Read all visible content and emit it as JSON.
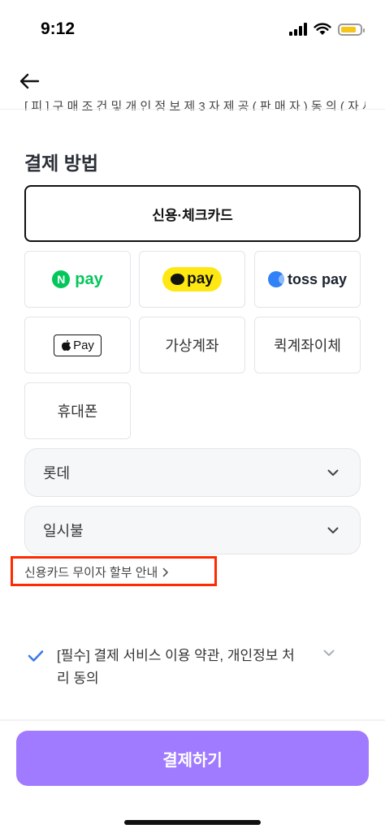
{
  "status_bar": {
    "time": "9:12"
  },
  "header": {
    "back_icon": "arrow-left-icon",
    "clipped_line": "[ 피 ] 구 매 조 건 및 개 인 정 보 제 3 자 제 공 ( 판 매 자 ) 동 의 ( 자 세 히 )"
  },
  "payment": {
    "title": "결제 방법",
    "card_label": "신용·체크카드",
    "methods": {
      "npay": {
        "mark": "N",
        "text": "pay"
      },
      "kakaopay": {
        "text": "pay"
      },
      "tosspay": {
        "text": "toss pay"
      },
      "applepay": {
        "text": "Pay"
      },
      "virtual_account": "가상계좌",
      "quick_transfer": "퀵계좌이체",
      "phone": "휴대폰"
    },
    "card_company": {
      "selected": "롯데"
    },
    "installment": {
      "selected": "일시불"
    },
    "installment_link": "신용카드 무이자 할부 안내"
  },
  "terms": {
    "label": "[필수] 결제 서비스 이용 약관, 개인정보 처리 동의"
  },
  "footer": {
    "pay_button": "결제하기"
  },
  "colors": {
    "accent": "#a07bff",
    "npay": "#03c75a",
    "kakao": "#ffe812",
    "toss": "#3182f6",
    "highlight": "#ff2a00"
  }
}
